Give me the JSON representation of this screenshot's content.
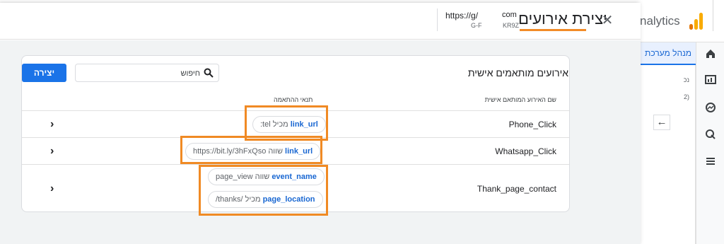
{
  "background_app": {
    "brand": "nalytics",
    "tab_label": "מנהל מערכת",
    "arrow_glyph": "←",
    "panel_text_1": "נכ",
    "panel_text_2": "2)"
  },
  "drawer": {
    "title": "יצירת אירועים",
    "close_glyph": "✕",
    "stream": {
      "url": "https://g/",
      "id": "G-F",
      "domain": "com",
      "mid": "KR9Z"
    }
  },
  "card": {
    "title": "אירועים מותאמים אישית",
    "search_placeholder": "חיפוש",
    "create_label": "יצירה",
    "col_name": "שם האירוע המותאם אישית",
    "col_conditions": "תנאי ההתאמה",
    "chevron_glyph": "›",
    "rows": [
      {
        "name": "Phone_Click",
        "conditions": [
          {
            "param": "link_url",
            "op": "מכיל",
            "value": ":tel"
          }
        ]
      },
      {
        "name": "Whatsapp_Click",
        "conditions": [
          {
            "param": "link_url",
            "op": "שווה",
            "value": "https://bit.ly/3hFxQso"
          }
        ]
      },
      {
        "name": "Thank_page_contact",
        "conditions": [
          {
            "param": "event_name",
            "op": "שווה",
            "value": "page_view"
          },
          {
            "param": "page_location",
            "op": "מכיל",
            "value": "/thanks/"
          }
        ]
      }
    ]
  },
  "colors": {
    "primary": "#1a73e8",
    "chip_text": "#1967d2",
    "highlight": "#f08a24",
    "body_bg": "#f1f3f4"
  }
}
